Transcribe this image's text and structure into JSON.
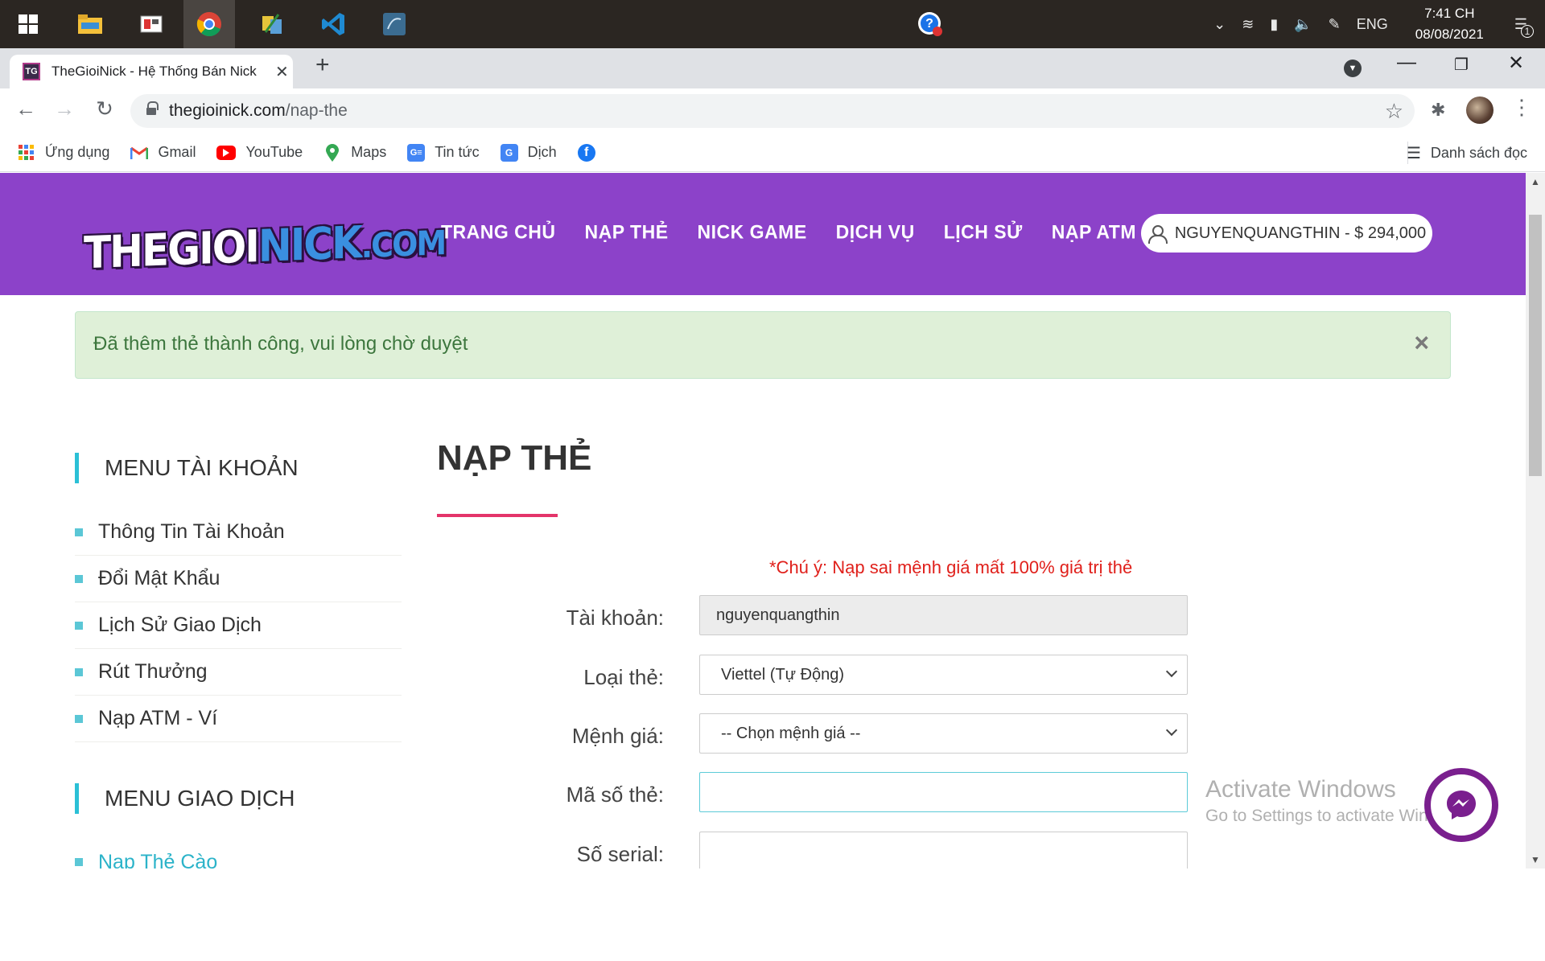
{
  "taskbar": {
    "language": "ENG",
    "time": "7:41 CH",
    "date": "08/08/2021",
    "notification_count": "1"
  },
  "browser": {
    "tab_title": "TheGioiNick - Hệ Thống Bán Nick",
    "tab_favicon_text": "TG",
    "url_host": "thegioinick.com",
    "url_path": "/nap-the",
    "bookmarks": [
      {
        "label": "Ứng dụng",
        "icon": "apps-grid-icon",
        "color": "#e94235"
      },
      {
        "label": "Gmail",
        "icon": "gmail-icon",
        "color": "#ea4335"
      },
      {
        "label": "YouTube",
        "icon": "youtube-icon",
        "color": "#ff0000"
      },
      {
        "label": "Maps",
        "icon": "maps-pin-icon",
        "color": "#34a853"
      },
      {
        "label": "Tin tức",
        "icon": "news-icon",
        "color": "#4285f4"
      },
      {
        "label": "Dịch",
        "icon": "translate-icon",
        "color": "#4285f4"
      }
    ],
    "reading_list": "Danh sách đọc"
  },
  "site": {
    "brand_color": "#8c42c9",
    "logo": {
      "part1": "THEGIOI",
      "part2": "NICK",
      "part3": ".COM"
    },
    "nav": [
      "TRANG CHỦ",
      "NẠP THẺ",
      "NICK GAME",
      "DỊCH VỤ",
      "LỊCH SỬ",
      "NẠP ATM - VÍ"
    ],
    "user_button": "NGUYENQUANGTHIN - $ 294,000"
  },
  "alert": {
    "message": "Đã thêm thẻ thành công, vui lòng chờ duyệt",
    "close": "×"
  },
  "sidebar": {
    "account_heading": "MENU TÀI KHOẢN",
    "account_items": [
      "Thông Tin Tài Khoản",
      "Đổi Mật Khẩu",
      "Lịch Sử Giao Dịch",
      "Rút Thưởng",
      "Nạp ATM - Ví"
    ],
    "transaction_heading": "MENU GIAO DỊCH",
    "transaction_items": [
      "Nạp Thẻ Cào"
    ]
  },
  "form": {
    "title": "NẠP THẺ",
    "note": "*Chú ý: Nạp sai mệnh giá mất 100% giá trị thẻ",
    "account_label": "Tài khoản:",
    "account_value": "nguyenquangthin",
    "card_type_label": "Loại thẻ:",
    "card_type_value": "Viettel (Tự Động)",
    "denomination_label": "Mệnh giá:",
    "denomination_value": "-- Chọn mệnh giá --",
    "card_code_label": "Mã số thẻ:",
    "card_code_value": "",
    "serial_label": "Số serial:",
    "serial_value": ""
  },
  "watermark": {
    "title": "Activate Windows",
    "subtitle": "Go to Settings to activate Windows."
  }
}
